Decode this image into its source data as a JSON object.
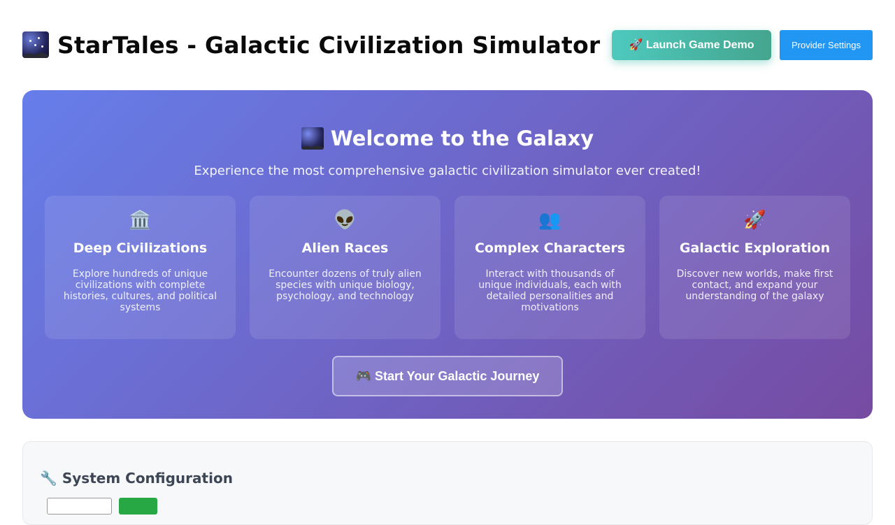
{
  "header": {
    "title": "StarTales - Galactic Civilization Simulator",
    "launch_button_label": "🚀 Launch Game Demo",
    "provider_button_label": "Provider Settings"
  },
  "hero": {
    "title": "Welcome to the Galaxy",
    "subtitle": "Experience the most comprehensive galactic civilization simulator ever created!",
    "features": [
      {
        "icon": "🏛️",
        "icon_name": "classical-building-icon",
        "title": "Deep Civilizations",
        "description": "Explore hundreds of unique civilizations with complete histories, cultures, and political systems"
      },
      {
        "icon": "👽",
        "icon_name": "alien-icon",
        "title": "Alien Races",
        "description": "Encounter dozens of truly alien species with unique biology, psychology, and technology"
      },
      {
        "icon": "👥",
        "icon_name": "people-icon",
        "title": "Complex Characters",
        "description": "Interact with thousands of unique individuals, each with detailed personalities and motivations"
      },
      {
        "icon": "🚀",
        "icon_name": "rocket-icon",
        "title": "Galactic Exploration",
        "description": "Discover new worlds, make first contact, and expand your understanding of the galaxy"
      }
    ],
    "start_button_label": "🎮 Start Your Galactic Journey"
  },
  "config": {
    "title": "🔧 System Configuration"
  },
  "colors": {
    "hero_gradient_start": "#667eea",
    "hero_gradient_end": "#764ba2",
    "launch_button": "#4ec9be",
    "provider_button": "#2196f3",
    "apply_button": "#28a745"
  }
}
